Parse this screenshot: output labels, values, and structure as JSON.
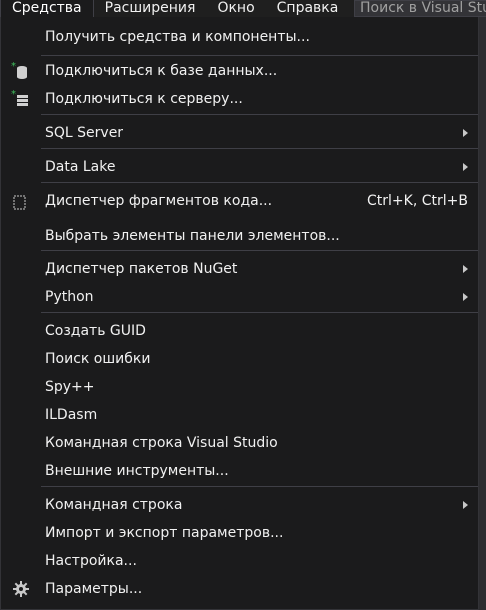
{
  "menubar": {
    "items": [
      {
        "label": "Средства"
      },
      {
        "label": "Расширения"
      },
      {
        "label": "Окно"
      },
      {
        "label": "Справка"
      }
    ],
    "search_placeholder": "Поиск в Visual Studio"
  },
  "menu": {
    "items": [
      {
        "label": "Получить средства и компоненты..."
      },
      {
        "label": "Подключиться к базе данных...",
        "icon": "database-add-icon"
      },
      {
        "label": "Подключиться к серверу...",
        "icon": "server-add-icon"
      },
      {
        "label": "SQL Server",
        "submenu": true
      },
      {
        "label": "Data Lake",
        "submenu": true
      },
      {
        "label": "Диспетчер фрагментов кода...",
        "shortcut": "Ctrl+K, Ctrl+B",
        "icon": "code-snippet-icon"
      },
      {
        "label": "Выбрать элементы панели элементов..."
      },
      {
        "label": "Диспетчер пакетов NuGet",
        "submenu": true
      },
      {
        "label": "Python",
        "submenu": true
      },
      {
        "label": "Создать GUID"
      },
      {
        "label": "Поиск ошибки"
      },
      {
        "label": "Spy++"
      },
      {
        "label": "ILDasm"
      },
      {
        "label": "Командная строка Visual Studio"
      },
      {
        "label": "Внешние инструменты..."
      },
      {
        "label": "Командная строка",
        "submenu": true
      },
      {
        "label": "Импорт и экспорт параметров..."
      },
      {
        "label": "Настройка..."
      },
      {
        "label": "Параметры...",
        "icon": "gear-icon"
      }
    ]
  },
  "colors": {
    "background": "#1b1b1c",
    "text": "#f1f1f1",
    "separator": "#3f3f46",
    "icon_green": "#3fbf5c"
  }
}
